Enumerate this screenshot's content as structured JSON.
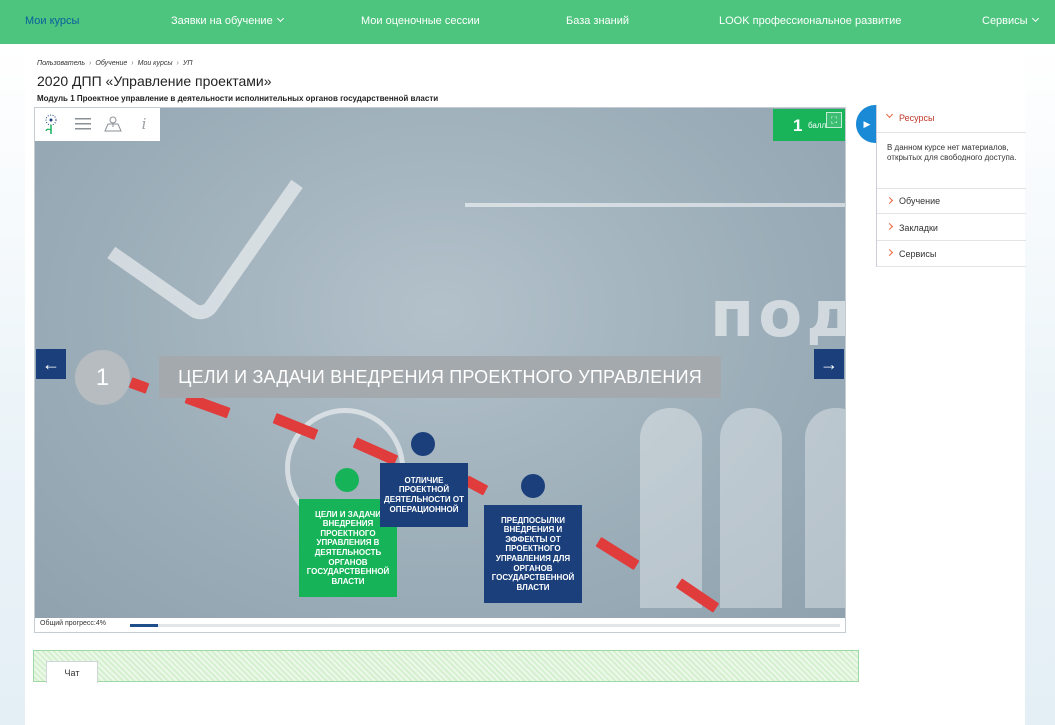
{
  "nav": {
    "items": [
      {
        "label": "Мои курсы",
        "active": true
      },
      {
        "label": "Заявки на обучение",
        "dropdown": true
      },
      {
        "label": "Мои оценочные сессии"
      },
      {
        "label": "База знаний"
      },
      {
        "label": "LOOK профессиональное развитие"
      },
      {
        "label": "Сервисы",
        "dropdown": true
      }
    ]
  },
  "breadcrumb": [
    "Пользователь",
    "Обучение",
    "Мои курсы",
    "УП"
  ],
  "page": {
    "title": "2020 ДПП «Управление проектами»",
    "module": "Модуль 1 Проектное управление в деятельности исполнительных органов государственной власти"
  },
  "player": {
    "toolbar_icons": [
      "logo-icon",
      "menu-icon",
      "map-icon",
      "info-icon"
    ],
    "score_value": "1",
    "score_label": "балл",
    "slide_number": "1",
    "slide_title": "ЦЕЛИ И ЗАДАЧИ ВНЕДРЕНИЯ ПРОЕКТНОГО УПРАВЛЕНИЯ",
    "nodes": [
      {
        "text": "ЦЕЛИ И ЗАДАЧИ ВНЕДРЕНИЯ ПРОЕКТНОГО УПРАВЛЕНИЯ В ДЕЯТЕЛЬНОСТЬ ОРГАНОВ ГОСУДАРСТВЕННОЙ ВЛАСТИ",
        "color": "#16b358"
      },
      {
        "text": "ОТЛИЧИЕ ПРОЕКТНОЙ ДЕЯТЕЛЬНОСТИ ОТ ОПЕРАЦИОННОЙ",
        "color": "#1a3f7a"
      },
      {
        "text": "ПРЕДПОСЫЛКИ ВНЕДРЕНИЯ И ЭФФЕКТЫ ОТ ПРОЕКТНОГО УПРАВЛЕНИЯ ДЛЯ ОРГАНОВ ГОСУДАРСТВЕННОЙ ВЛАСТИ",
        "color": "#1a3f7a"
      }
    ],
    "progress_label": "Общий прогресс:4%",
    "progress_percent": 4,
    "prev_symbol": "←",
    "next_symbol": "→",
    "fullscreen_symbol": "⛶",
    "chalk_text": "подо"
  },
  "panel": {
    "toggle_symbol": "▶",
    "resources_label": "Ресурсы",
    "resources_desc": "В данном курсе нет материалов, открытых для свободного доступа.",
    "items": [
      "Обучение",
      "Закладки",
      "Сервисы"
    ]
  },
  "chat": {
    "tab_label": "Чат"
  },
  "colors": {
    "nav_bg": "#4dc57e",
    "accent_blue": "#1a3f7a",
    "accent_green": "#16b358",
    "dash_red": "#e03c3c"
  }
}
